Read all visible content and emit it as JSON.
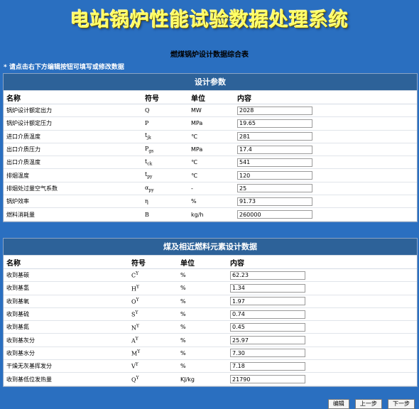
{
  "app_title": "电站锅炉性能试验数据处理系统",
  "page_title": "燃煤锅炉设计数据综合表",
  "hint": "* 请点击右下方编辑按钮可填写或修改数据",
  "design_params": {
    "header": "设计参数",
    "columns": [
      "名称",
      "符号",
      "单位",
      "内容"
    ],
    "rows": [
      {
        "name": "锅炉设计额定出力",
        "sym": "Q",
        "unit": "MW",
        "value": "2028"
      },
      {
        "name": "锅炉设计额定压力",
        "sym": "P",
        "unit": "MPa",
        "value": "19.65"
      },
      {
        "name": "进口介质温度",
        "sym": "t",
        "sub": "jk",
        "unit": "℃",
        "value": "281"
      },
      {
        "name": "出口介质压力",
        "sym": "P",
        "sub": "gs",
        "unit": "MPa",
        "value": "17.4"
      },
      {
        "name": "出口介质温度",
        "sym": "t",
        "sub": "ck",
        "unit": "℃",
        "value": "541"
      },
      {
        "name": "排烟温度",
        "sym": "t",
        "sub": "py",
        "unit": "℃",
        "value": "120"
      },
      {
        "name": "排烟处过量空气系数",
        "sym": "α",
        "sub": "py",
        "unit": "-",
        "value": "25"
      },
      {
        "name": "锅炉效率",
        "sym": "η",
        "unit": "%",
        "value": "91.73"
      },
      {
        "name": "燃料消耗量",
        "sym": "B",
        "unit": "kg/h",
        "value": "260000"
      }
    ]
  },
  "coal_data": {
    "header": "煤及相近燃料元素设计数据",
    "columns": [
      "名称",
      "符号",
      "单位",
      "内容"
    ],
    "rows": [
      {
        "name": "收到基碳",
        "sym": "C",
        "sup": "Y",
        "unit": "%",
        "value": "62.23"
      },
      {
        "name": "收到基氢",
        "sym": "H",
        "sup": "Y",
        "unit": "%",
        "value": "1.34"
      },
      {
        "name": "收到基氧",
        "sym": "O",
        "sup": "Y",
        "unit": "%",
        "value": "1.97"
      },
      {
        "name": "收到基硫",
        "sym": "S",
        "sup": "Y",
        "unit": "%",
        "value": "0.74"
      },
      {
        "name": "收到基氮",
        "sym": "N",
        "sup": "Y",
        "unit": "%",
        "value": "0.45"
      },
      {
        "name": "收到基灰分",
        "sym": "A",
        "sup": "Y",
        "unit": "%",
        "value": "25.97"
      },
      {
        "name": "收到基水分",
        "sym": "M",
        "sup": "Y",
        "unit": "%",
        "value": "7.30"
      },
      {
        "name": "干燥无灰基挥发分",
        "sym": "V",
        "sup": "Y",
        "unit": "%",
        "value": "7.18"
      },
      {
        "name": "收到基低位发热量",
        "sym": "Q",
        "sup": "Y",
        "unit": "KJ/kg",
        "value": "21790"
      }
    ]
  },
  "buttons": {
    "edit": "编辑",
    "prev": "上一步",
    "next": "下一步"
  }
}
